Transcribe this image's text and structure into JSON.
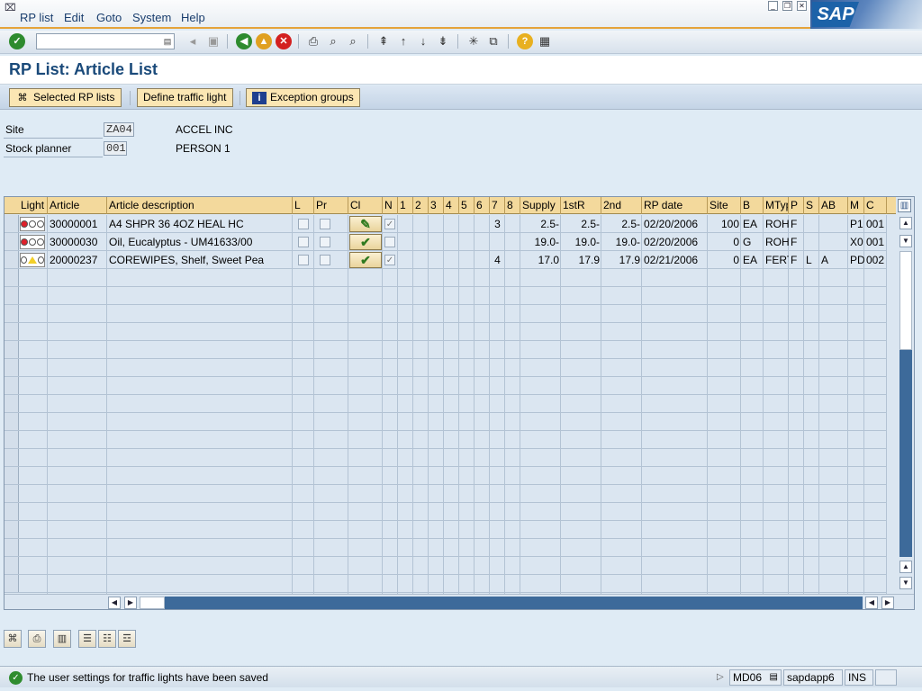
{
  "menu": {
    "items": [
      "RP list",
      "Edit",
      "Goto",
      "System",
      "Help"
    ]
  },
  "window": {
    "logo": "SAP"
  },
  "toolbar": {
    "command_value": ""
  },
  "screen": {
    "title": "RP List: Article List"
  },
  "app_toolbar": {
    "selected_rp_lists": "Selected RP lists",
    "define_traffic_light": "Define traffic light",
    "exception_groups": "Exception groups"
  },
  "header": {
    "site_label": "Site",
    "site_value": "ZA04",
    "site_name": "ACCEL INC",
    "planner_label": "Stock planner",
    "planner_value": "001",
    "planner_name": "PERSON 1"
  },
  "grid": {
    "columns": [
      "Light",
      "Article",
      "Article description",
      "L",
      "Pr",
      "Cl",
      "N",
      "1",
      "2",
      "3",
      "4",
      "5",
      "6",
      "7",
      "8",
      "Supply",
      "1stR",
      "2nd",
      "RP date",
      "Site",
      "B",
      "MTyp",
      "P",
      "S",
      "AB",
      "M",
      "C"
    ],
    "rows": [
      {
        "light": "red",
        "article": "30000001",
        "desc": "A4 SHPR 36 4OZ HEAL HC",
        "L": false,
        "Pr": false,
        "cl": "edit-check",
        "N": true,
        "c7": "3",
        "supply": "2.5-",
        "first": "2.5-",
        "second": "2.5-",
        "rpdate": "02/20/2006",
        "site": "100",
        "B": "EA",
        "mtyp": "ROH",
        "P": "F",
        "S": "",
        "AB": "",
        "M": "P1",
        "C": "001"
      },
      {
        "light": "red",
        "article": "30000030",
        "desc": "Oil, Eucalyptus - UM41633/00",
        "L": false,
        "Pr": false,
        "cl": "check",
        "N": false,
        "c7": "",
        "supply": "19.0-",
        "first": "19.0-",
        "second": "19.0-",
        "rpdate": "02/20/2006",
        "site": "0",
        "B": "G",
        "mtyp": "ROH",
        "P": "F",
        "S": "",
        "AB": "",
        "M": "X0",
        "C": "001"
      },
      {
        "light": "yellow",
        "article": "20000237",
        "desc": "COREWIPES, Shelf, Sweet Pea",
        "L": false,
        "Pr": false,
        "cl": "check",
        "N": true,
        "c7": "4",
        "supply": "17.0",
        "first": "17.9",
        "second": "17.9",
        "rpdate": "02/21/2006",
        "site": "0",
        "B": "EA",
        "mtyp": "FERT",
        "P": "F",
        "S": "L",
        "AB": "A",
        "M": "PD",
        "C": "002"
      }
    ]
  },
  "status": {
    "message": "The user settings for traffic lights have been saved",
    "transaction": "MD06",
    "server": "sapdapp6",
    "mode": "INS"
  },
  "colors": {
    "accent": "#e5a33a",
    "header_bg": "#f3d99c",
    "red_light": "#e0202a",
    "yellow_light": "#f2cf2a"
  }
}
